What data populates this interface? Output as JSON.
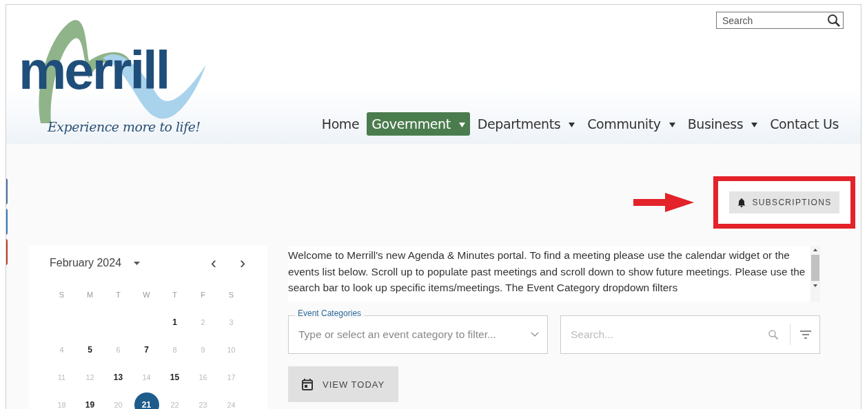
{
  "logo": {
    "wordmark": "merrill",
    "tagline": "Experience more to life!"
  },
  "site_search": {
    "placeholder": "Search"
  },
  "nav": [
    {
      "label": "Home",
      "dropdown": false,
      "selected": false
    },
    {
      "label": "Government",
      "dropdown": true,
      "selected": true
    },
    {
      "label": "Departments",
      "dropdown": true,
      "selected": false
    },
    {
      "label": "Community",
      "dropdown": true,
      "selected": false
    },
    {
      "label": "Business",
      "dropdown": true,
      "selected": false
    },
    {
      "label": "Contact Us",
      "dropdown": false,
      "selected": false
    }
  ],
  "side_tabs": [
    {
      "color": "#4a6fa5"
    },
    {
      "color": "#3b78b8"
    },
    {
      "color": "#c0392b"
    }
  ],
  "subscriptions_button": {
    "label": "SUBSCRIPTIONS"
  },
  "calendar": {
    "month": "February 2024",
    "prev": "‹",
    "next": "›",
    "weekdays": [
      "S",
      "M",
      "T",
      "W",
      "T",
      "F",
      "S"
    ],
    "days": [
      {
        "kind": "blank"
      },
      {
        "kind": "blank"
      },
      {
        "kind": "blank"
      },
      {
        "kind": "blank"
      },
      {
        "kind": "day",
        "label": "1",
        "has_events": true,
        "selected": false
      },
      {
        "kind": "day",
        "label": "2",
        "has_events": false,
        "selected": false
      },
      {
        "kind": "day",
        "label": "3",
        "has_events": false,
        "selected": false
      },
      {
        "kind": "day",
        "label": "4",
        "has_events": false,
        "selected": false
      },
      {
        "kind": "day",
        "label": "5",
        "has_events": true,
        "selected": false
      },
      {
        "kind": "day",
        "label": "6",
        "has_events": false,
        "selected": false
      },
      {
        "kind": "day",
        "label": "7",
        "has_events": true,
        "selected": false
      },
      {
        "kind": "day",
        "label": "8",
        "has_events": false,
        "selected": false
      },
      {
        "kind": "day",
        "label": "9",
        "has_events": false,
        "selected": false
      },
      {
        "kind": "day",
        "label": "10",
        "has_events": false,
        "selected": false
      },
      {
        "kind": "day",
        "label": "11",
        "has_events": false,
        "selected": false
      },
      {
        "kind": "day",
        "label": "12",
        "has_events": false,
        "selected": false
      },
      {
        "kind": "day",
        "label": "13",
        "has_events": true,
        "selected": false
      },
      {
        "kind": "day",
        "label": "14",
        "has_events": false,
        "selected": false
      },
      {
        "kind": "day",
        "label": "15",
        "has_events": true,
        "selected": false
      },
      {
        "kind": "day",
        "label": "16",
        "has_events": false,
        "selected": false
      },
      {
        "kind": "day",
        "label": "17",
        "has_events": false,
        "selected": false
      },
      {
        "kind": "day",
        "label": "18",
        "has_events": false,
        "selected": false
      },
      {
        "kind": "day",
        "label": "19",
        "has_events": true,
        "selected": false
      },
      {
        "kind": "day",
        "label": "20",
        "has_events": false,
        "selected": false
      },
      {
        "kind": "day",
        "label": "21",
        "has_events": true,
        "selected": true
      },
      {
        "kind": "day",
        "label": "22",
        "has_events": false,
        "selected": false
      },
      {
        "kind": "day",
        "label": "23",
        "has_events": false,
        "selected": false
      },
      {
        "kind": "day",
        "label": "24",
        "has_events": false,
        "selected": false
      }
    ]
  },
  "intro": "Welcome to Merrill's new Agenda & Minutes portal. To find a meeting please use the calendar widget or the events list below. Scroll up to populate past meetings and scroll down to show future meetings. Please use the search bar to look up specific items/meetings. The Event Category dropdown filters",
  "category_field": {
    "label": "Event Categories",
    "placeholder": "Type or select an event category to filter..."
  },
  "event_search": {
    "placeholder": "Search..."
  },
  "view_today_button": {
    "label": "VIEW TODAY"
  }
}
